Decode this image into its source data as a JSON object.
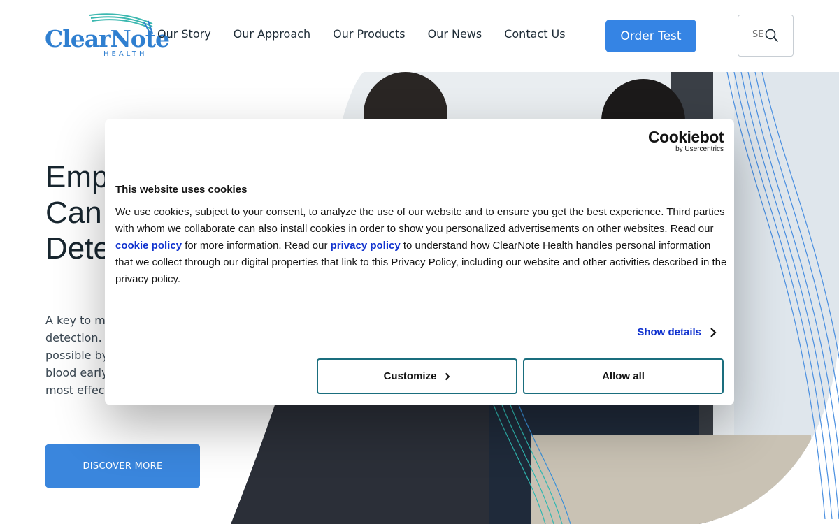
{
  "header": {
    "logo": {
      "name": "ClearNote",
      "sub": "HEALTH"
    },
    "nav": [
      {
        "label": "Our Story"
      },
      {
        "label": "Our Approach"
      },
      {
        "label": "Our Products"
      },
      {
        "label": "Our News"
      },
      {
        "label": "Contact Us"
      }
    ],
    "order_label": "Order Test",
    "search": {
      "placeholder": "SEARCH",
      "icon": "search-icon"
    }
  },
  "hero": {
    "headline_lines": [
      "Emp",
      "Can",
      "Dete"
    ],
    "body_lines": [
      "A key to m",
      "detection.",
      "possible by",
      "blood early",
      "most effec"
    ],
    "button_label": "DISCOVER MORE"
  },
  "cookie_banner": {
    "brand": "Cookiebot",
    "brand_sub": "by Usercentrics",
    "title": "This website uses cookies",
    "text_part1": "We use cookies, subject to your consent, to analyze the use of our website and to ensure you get the best experience. Third parties with whom we collaborate can also install cookies in order to show you personalized advertisements on other websites. Read our ",
    "cookie_policy_label": "cookie policy",
    "text_part2": " for more information.  Read our ",
    "privacy_policy_label": "privacy policy",
    "text_part3": " to understand how ClearNote Health handles personal information that we collect through our digital properties that link to this Privacy Policy, including our website and other activities described in the privacy policy.",
    "show_details_label": "Show details",
    "customize_label": "Customize",
    "allow_all_label": "Allow all"
  },
  "colors": {
    "brand_blue": "#3584e4",
    "link_blue": "#1032cf",
    "button_border": "#1a6e7e",
    "headline": "#18262f"
  }
}
